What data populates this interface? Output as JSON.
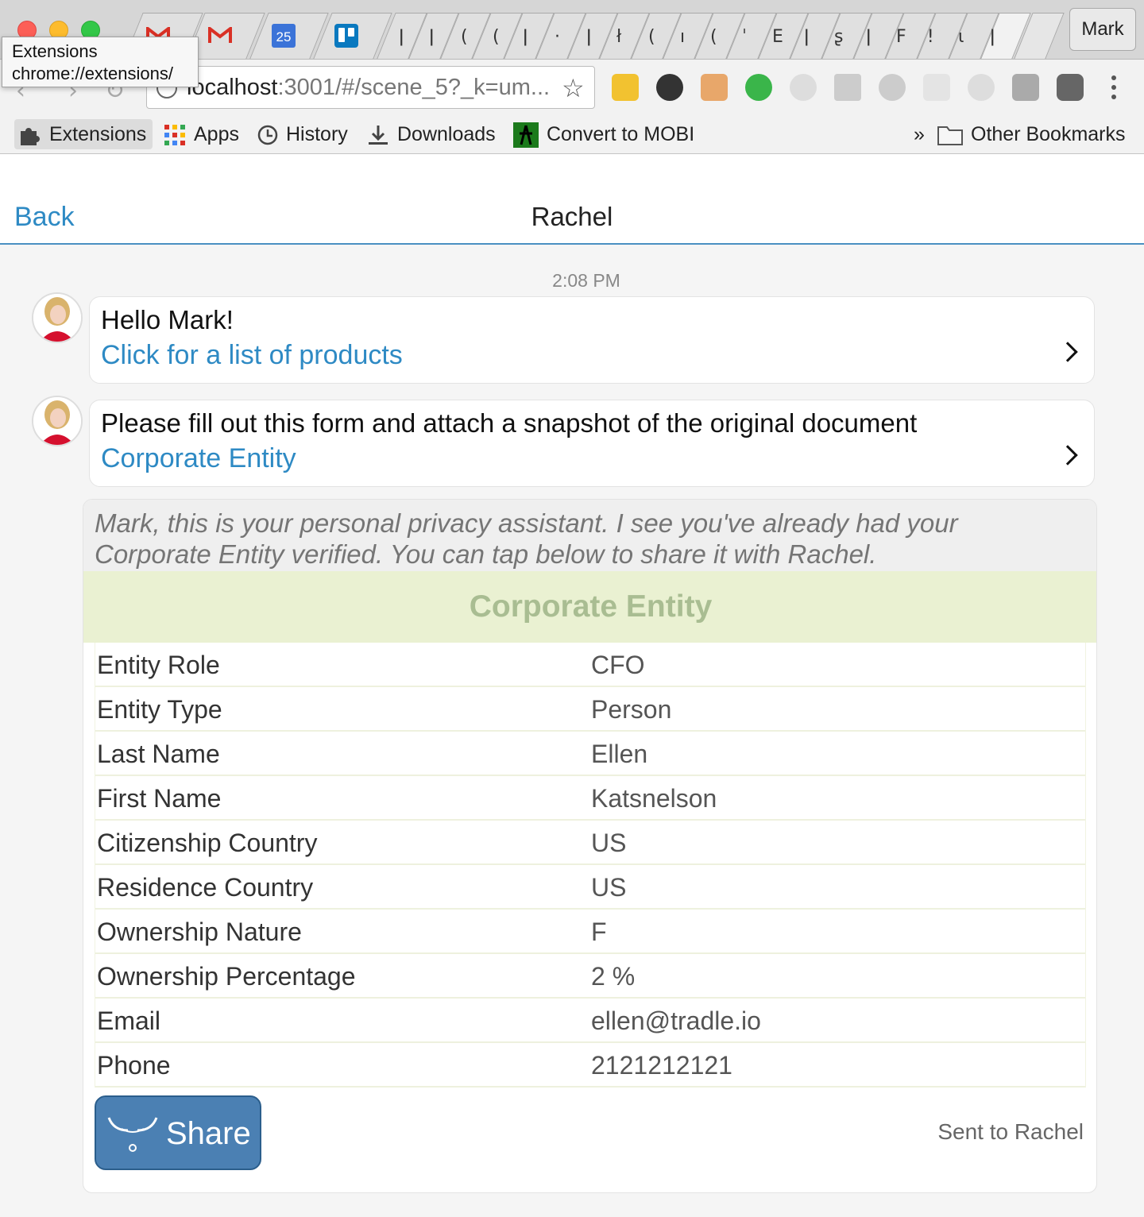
{
  "browser": {
    "profile_name": "Mark",
    "address": {
      "host": "localhost",
      "rest": ":3001/#/scene_5?_k=um..."
    },
    "tooltip": {
      "title": "Extensions",
      "url": "chrome://extensions/"
    },
    "bookmarks": [
      {
        "label": "Extensions",
        "icon": "puzzle-icon"
      },
      {
        "label": "Apps",
        "icon": "apps-grid-icon"
      },
      {
        "label": "History",
        "icon": "history-icon"
      },
      {
        "label": "Downloads",
        "icon": "download-icon"
      },
      {
        "label": "Convert to MOBI",
        "icon": "mobi-icon"
      }
    ],
    "bookmarks_overflow": "»",
    "other_bookmarks": "Other Bookmarks",
    "calendar_tab_day": "25"
  },
  "app": {
    "header": {
      "back_label": "Back",
      "title": "Rachel"
    },
    "timestamp": "2:08 PM",
    "messages": [
      {
        "text": "Hello Mark!",
        "link": "Click for a list of products"
      },
      {
        "text": "Please fill out this form and attach a snapshot of the original document",
        "link": "Corporate Entity"
      }
    ],
    "verification": {
      "assistant_text_line1": "Mark, this is your personal privacy assistant. I see you've already had your",
      "assistant_text_line2": "Corporate Entity verified. You can tap below to share it with Rachel.",
      "title": "Corporate Entity",
      "properties": [
        {
          "label": "Entity Role",
          "value": "CFO"
        },
        {
          "label": "Entity Type",
          "value": "Person"
        },
        {
          "label": "Last Name",
          "value": "Ellen"
        },
        {
          "label": "First Name",
          "value": "Katsnelson"
        },
        {
          "label": "Citizenship Country",
          "value": "US"
        },
        {
          "label": "Residence Country",
          "value": "US"
        },
        {
          "label": "Ownership Nature",
          "value": "F"
        },
        {
          "label": "Ownership Percentage",
          "value": "2 %"
        },
        {
          "label": "Email",
          "value": "ellen@tradle.io"
        },
        {
          "label": "Phone",
          "value": "2121212121"
        }
      ],
      "share_label": "Share",
      "status": "Sent to Rachel"
    }
  },
  "colors": {
    "link": "#2e8ac4",
    "share_button": "#4b80b3",
    "verified_banner": "#eaf1d2",
    "verified_title": "#a9bd92"
  }
}
